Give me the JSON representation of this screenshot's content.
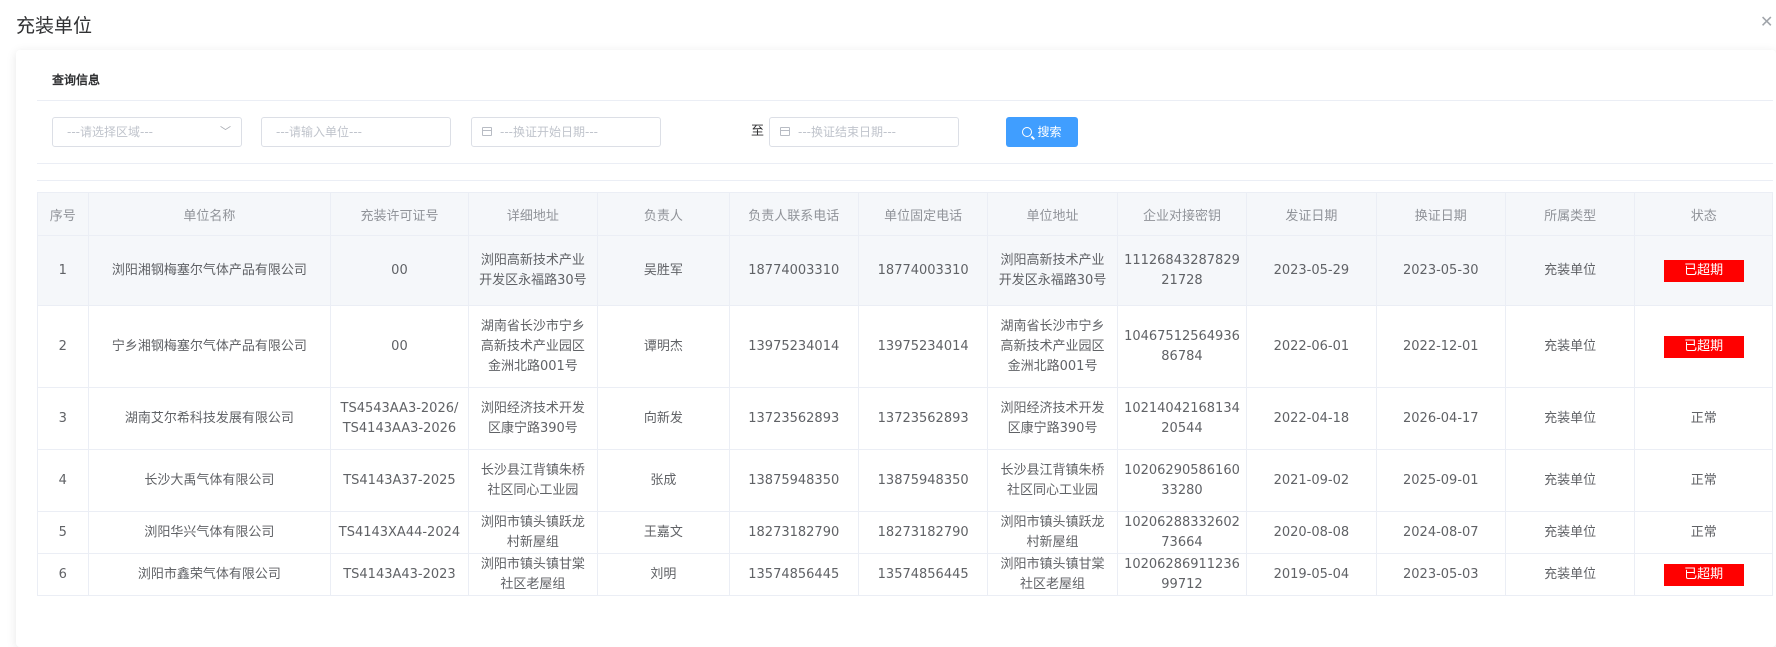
{
  "dialog": {
    "title": "充装单位"
  },
  "query": {
    "section_title": "查询信息",
    "region_placeholder": "---请选择区域---",
    "unit_placeholder": "---请输入单位---",
    "start_date_placeholder": "---换证开始日期---",
    "to_label": "至",
    "end_date_placeholder": "---换证结束日期---",
    "search_label": "搜索"
  },
  "table": {
    "columns": [
      "序号",
      "单位名称",
      "充装许可证号",
      "详细地址",
      "负责人",
      "负责人联系电话",
      "单位固定电话",
      "单位地址",
      "企业对接密钥",
      "发证日期",
      "换证日期",
      "所属类型",
      "状态"
    ],
    "rows": [
      {
        "no": "1",
        "name": "浏阳湘钢梅塞尔气体产品有限公司",
        "license": "00",
        "address": "浏阳高新技术产业开发区永福路30号",
        "person": "吴胜军",
        "mobile": "18774003310",
        "phone": "18774003310",
        "unit_address": "浏阳高新技术产业开发区永福路30号",
        "key": "1112684328782921728",
        "issue": "2023-05-29",
        "renew": "2023-05-30",
        "type": "充装单位",
        "status": "已超期",
        "expired": true
      },
      {
        "no": "2",
        "name": "宁乡湘钢梅塞尔气体产品有限公司",
        "license": "00",
        "address": "湖南省长沙市宁乡高新技术产业园区金洲北路001号",
        "person": "谭明杰",
        "mobile": "13975234014",
        "phone": "13975234014",
        "unit_address": "湖南省长沙市宁乡高新技术产业园区金洲北路001号",
        "key": "1046751256493686784",
        "issue": "2022-06-01",
        "renew": "2022-12-01",
        "type": "充装单位",
        "status": "已超期",
        "expired": true
      },
      {
        "no": "3",
        "name": "湖南艾尔希科技发展有限公司",
        "license": "TS4543AA3-2026/TS4143AA3-2026",
        "address": "浏阳经济技术开发区康宁路390号",
        "person": "向新发",
        "mobile": "13723562893",
        "phone": "13723562893",
        "unit_address": "浏阳经济技术开发区康宁路390号",
        "key": "1021404216813420544",
        "issue": "2022-04-18",
        "renew": "2026-04-17",
        "type": "充装单位",
        "status": "正常",
        "expired": false
      },
      {
        "no": "4",
        "name": "长沙大禹气体有限公司",
        "license": "TS4143A37-2025",
        "address": "长沙县江背镇朱桥社区同心工业园",
        "person": "张成",
        "mobile": "13875948350",
        "phone": "13875948350",
        "unit_address": "长沙县江背镇朱桥社区同心工业园",
        "key": "1020629058616033280",
        "issue": "2021-09-02",
        "renew": "2025-09-01",
        "type": "充装单位",
        "status": "正常",
        "expired": false
      },
      {
        "no": "5",
        "name": "浏阳华兴气体有限公司",
        "license": "TS4143XA44-2024",
        "address": "浏阳市镇头镇跃龙村新屋组",
        "person": "王嘉文",
        "mobile": "18273182790",
        "phone": "18273182790",
        "unit_address": "浏阳市镇头镇跃龙村新屋组",
        "key": "1020628833260273664",
        "issue": "2020-08-08",
        "renew": "2024-08-07",
        "type": "充装单位",
        "status": "正常",
        "expired": false
      },
      {
        "no": "6",
        "name": "浏阳市鑫荣气体有限公司",
        "license": "TS4143A43-2023",
        "address": "浏阳市镇头镇甘棠社区老屋组",
        "person": "刘明",
        "mobile": "13574856445",
        "phone": "13574856445",
        "unit_address": "浏阳市镇头镇甘棠社区老屋组",
        "key": "1020628691123699712",
        "issue": "2019-05-04",
        "renew": "2023-05-03",
        "type": "充装单位",
        "status": "已超期",
        "expired": true
      }
    ]
  },
  "colors": {
    "primary": "#409eff",
    "expired": "#ff0000"
  }
}
